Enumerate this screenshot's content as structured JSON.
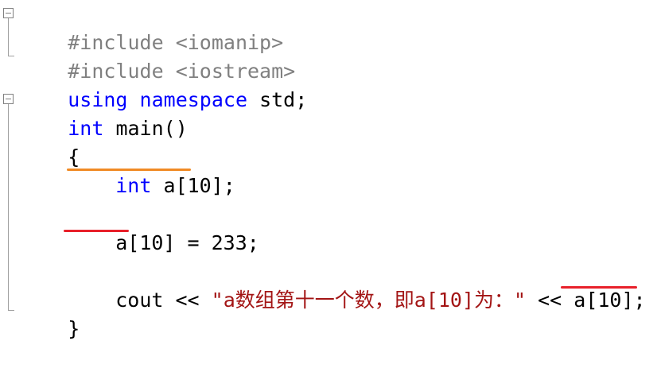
{
  "code": {
    "line1": {
      "directive": "#include",
      "header": "<iomanip>"
    },
    "line2": {
      "directive": "#include",
      "header": "<iostream>"
    },
    "line3": {
      "kw1": "using",
      "kw2": "namespace",
      "rest": "std;"
    },
    "line4": {
      "kw": "int",
      "rest": "main()"
    },
    "line5": {
      "text": "{"
    },
    "line6": {
      "kw": "int",
      "rest": "a[10];"
    },
    "line7": {
      "text": "a[10] = 233;"
    },
    "line8": {
      "cout": "cout << ",
      "string": "\"a数组第十一个数，即a[10]为：\"",
      "op": " << ",
      "expr": "a[10]",
      "semi": ";"
    },
    "line9": {
      "text": "}"
    }
  },
  "colors": {
    "keyword": "#0000ff",
    "preprocessor": "#808080",
    "string": "#a31515",
    "underline_orange": "#f08a24",
    "underline_red": "#e8202a"
  }
}
